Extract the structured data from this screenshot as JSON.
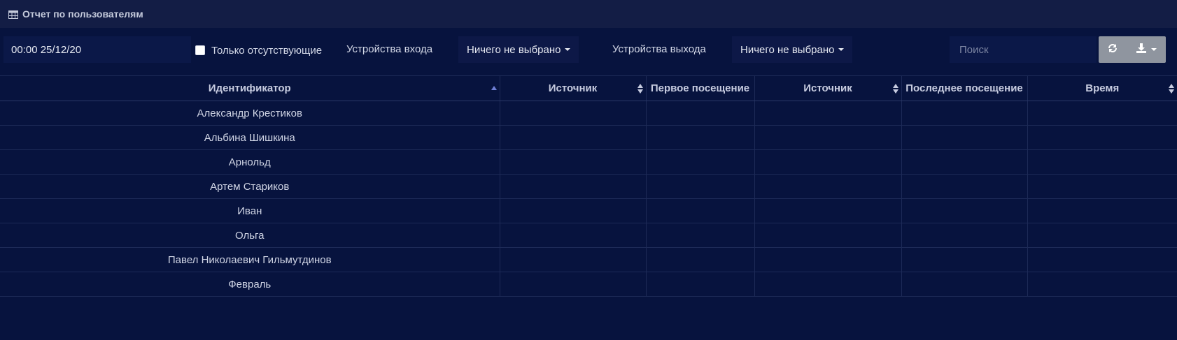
{
  "header": {
    "title": "Отчет по пользователям",
    "icon": "table-icon"
  },
  "toolbar": {
    "date_value": "00:00 25/12/20",
    "only_absent_label": "Только отсутствующие",
    "only_absent_checked": false,
    "entry_devices_label": "Устройства входа",
    "entry_devices_value": "Ничего не выбрано",
    "exit_devices_label": "Устройства выхода",
    "exit_devices_value": "Ничего не выбрано",
    "search_placeholder": "Поиск",
    "refresh_icon": "refresh-icon",
    "download_icon": "download-icon"
  },
  "table": {
    "columns": [
      "Идентификатор",
      "Источник",
      "Первое посещение",
      "Источник",
      "Последнее посещение",
      "Время"
    ],
    "sorted_column": "Идентификатор",
    "sort_direction": "asc",
    "rows": [
      [
        "Александр Крестиков",
        "",
        "",
        "",
        "",
        ""
      ],
      [
        "Альбина Шишкина",
        "",
        "",
        "",
        "",
        ""
      ],
      [
        "Арнольд",
        "",
        "",
        "",
        "",
        ""
      ],
      [
        "Артем Стариков",
        "",
        "",
        "",
        "",
        ""
      ],
      [
        "Иван",
        "",
        "",
        "",
        "",
        ""
      ],
      [
        "Ольга",
        "",
        "",
        "",
        "",
        ""
      ],
      [
        "Павел Николаевич Гильмутдинов",
        "",
        "",
        "",
        "",
        ""
      ],
      [
        "Февраль",
        "",
        "",
        "",
        "",
        ""
      ]
    ]
  },
  "colors": {
    "background": "#07133e",
    "header_bar": "#131d45",
    "accent_sort": "#6f7fd6",
    "button_group": "#8f959f"
  }
}
